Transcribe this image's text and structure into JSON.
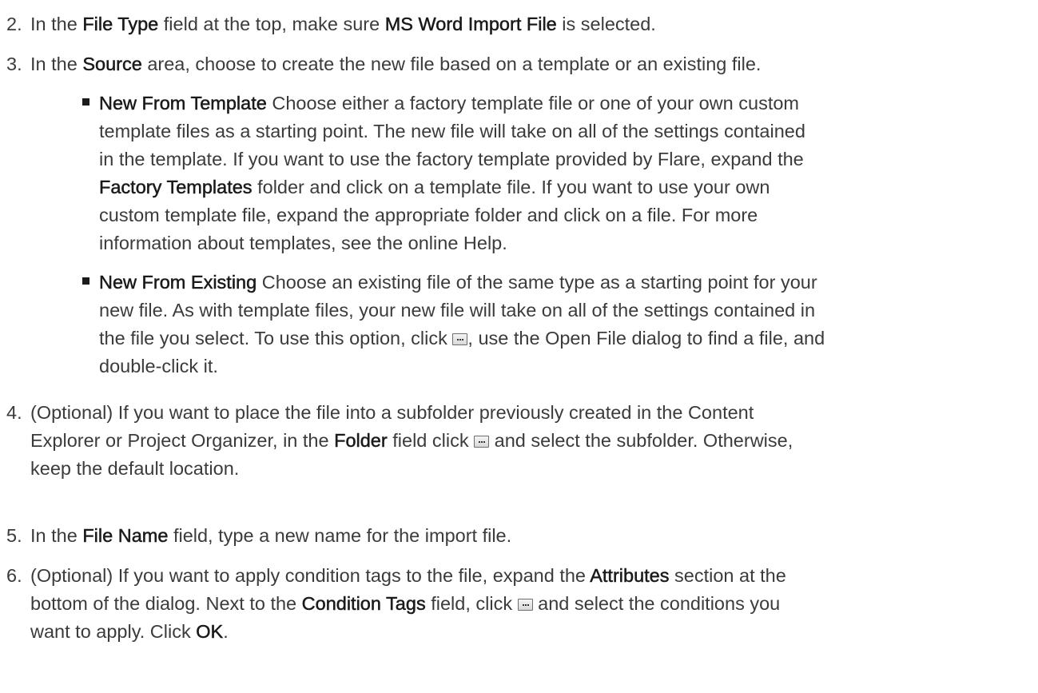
{
  "steps": [
    {
      "number": "2.",
      "parts": [
        "In the ",
        "File Type",
        " field at the top, make sure ",
        "MS Word Import File",
        " is selected."
      ]
    },
    {
      "number": "3.",
      "parts": [
        "In the ",
        "Source",
        " area, choose to create the new file based on a template or an existing file."
      ],
      "bullets": [
        {
          "term": "New From Template",
          "lines": [
            " Choose either a factory template file or one of your own custom",
            "template files as a starting point. The new file will take on all of the settings contained",
            "in the template. If you want to use the factory template provided by Flare, expand the",
            "Factory Templates",
            " folder and click on a template file. If you want to use your own",
            "custom template file, expand the appropriate folder and click on a file. For more",
            "information about templates, see the online Help."
          ]
        },
        {
          "term": "New From Existing",
          "lines": [
            " Choose an existing file of the same type as a starting point for your",
            "new file. As with template files, your new file will take on all of the settings contained in",
            "the file you select. To use this option, click ",
            ", use the Open File dialog to find a file, and",
            "double-click it."
          ]
        }
      ]
    },
    {
      "number": "4.",
      "lines": [
        "(Optional) If you want to place the file into a subfolder previously created in the Content",
        "Explorer or Project Organizer, in the ",
        "Folder",
        " field click ",
        " and select the subfolder. Otherwise,",
        "keep the default location."
      ]
    },
    {
      "number": "5.",
      "parts": [
        "In the ",
        "File Name",
        " field, type a new name for the import file."
      ]
    },
    {
      "number": "6.",
      "lines": [
        "(Optional) If you want to apply condition tags to the file, expand the ",
        "Attributes",
        " section at the",
        "bottom of the dialog. Next to the ",
        "Condition Tags",
        " field, click ",
        " and select the conditions you",
        "want to apply. Click ",
        "OK",
        "."
      ]
    }
  ],
  "icons": {
    "browse_button": "ellipsis-browse-icon"
  }
}
